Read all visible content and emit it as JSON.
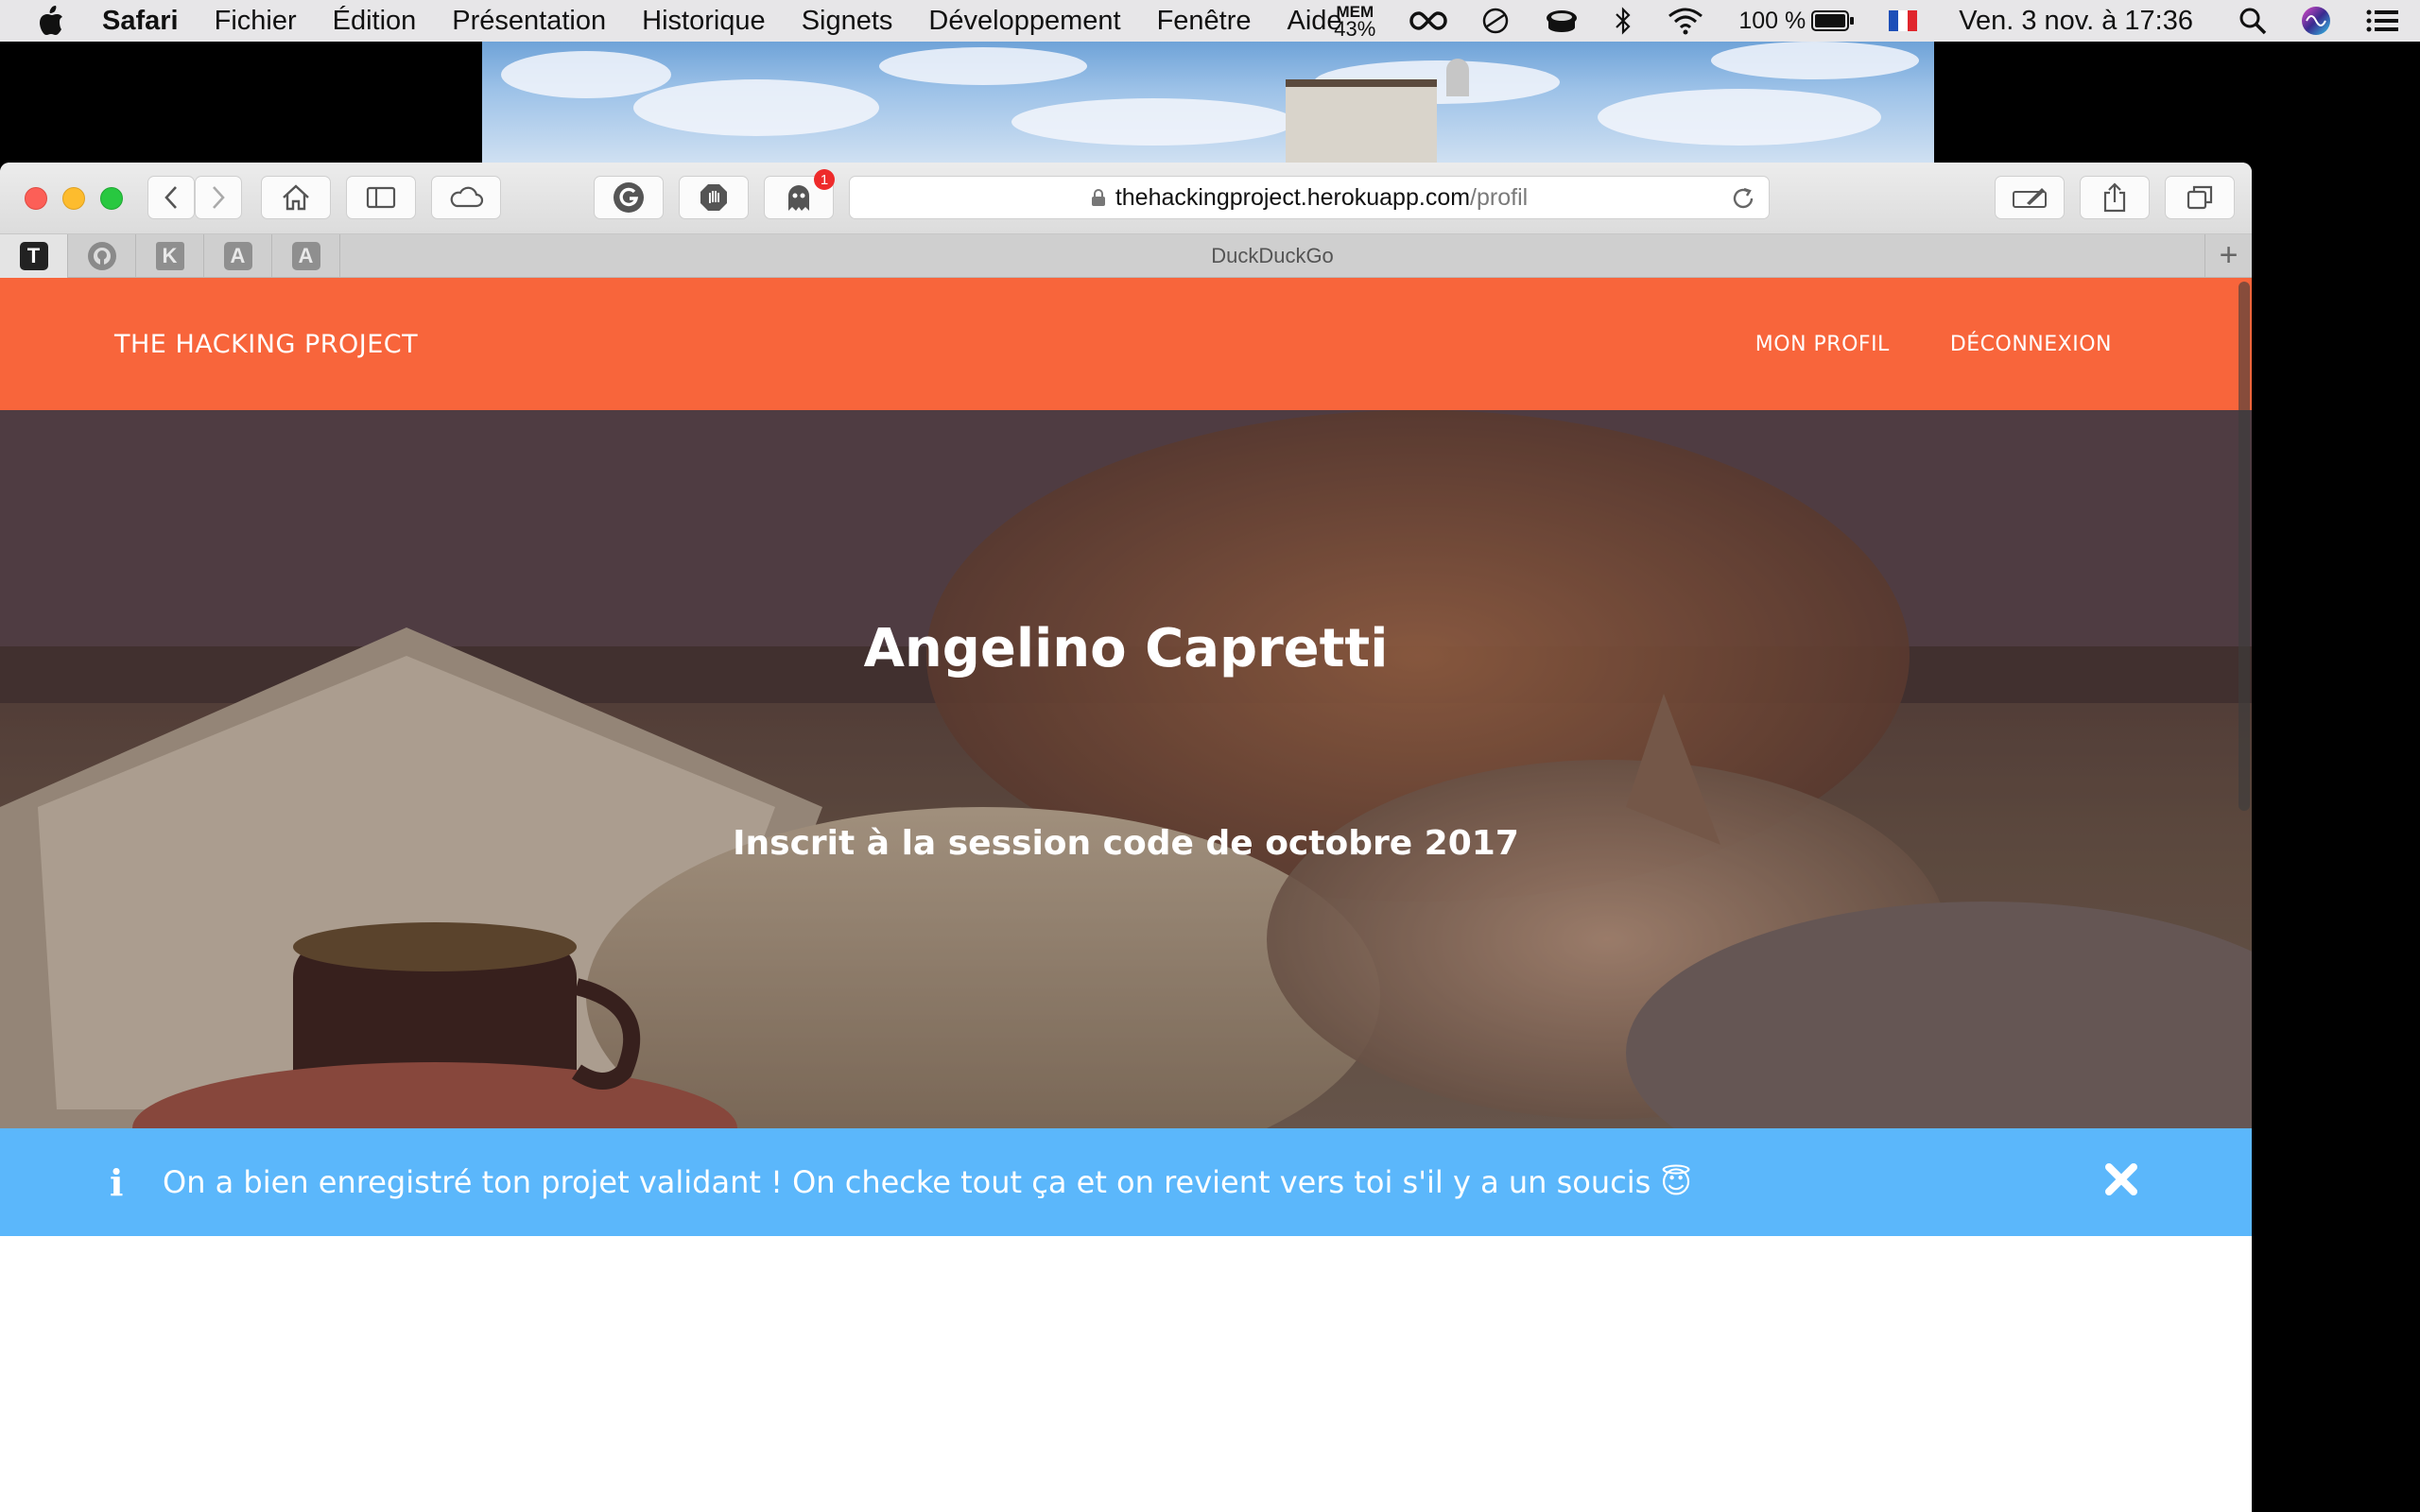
{
  "menubar": {
    "app_name": "Safari",
    "items": [
      "Fichier",
      "Édition",
      "Présentation",
      "Historique",
      "Signets",
      "Développement",
      "Fenêtre",
      "Aide"
    ],
    "mem_label": "MEM",
    "mem_value": "43%",
    "battery": "100 %",
    "clock": "Ven. 3 nov. à 17:36",
    "flag": "fr"
  },
  "toolbar": {
    "url_host": "thehackingproject.herokuapp.com",
    "url_path": "/profil",
    "badge_count": "1"
  },
  "tabbar": {
    "pinned": [
      "T",
      "github",
      "K",
      "A",
      "A"
    ],
    "active_title": "DuckDuckGo",
    "new_tab": "+"
  },
  "site": {
    "brand": "THE HACKING PROJECT",
    "nav": [
      "MON PROFIL",
      "DÉCONNEXION"
    ],
    "colors": {
      "navbar": "#f8653b",
      "alert": "#5bb7fb"
    }
  },
  "hero": {
    "name": "Angelino Capretti",
    "subtitle": "Inscrit à la session code de octobre 2017"
  },
  "alert": {
    "icon": "i",
    "message": "On a bien enregistré ton projet validant ! On checke tout ça et on revient vers toi s'il y a un soucis 😇"
  }
}
